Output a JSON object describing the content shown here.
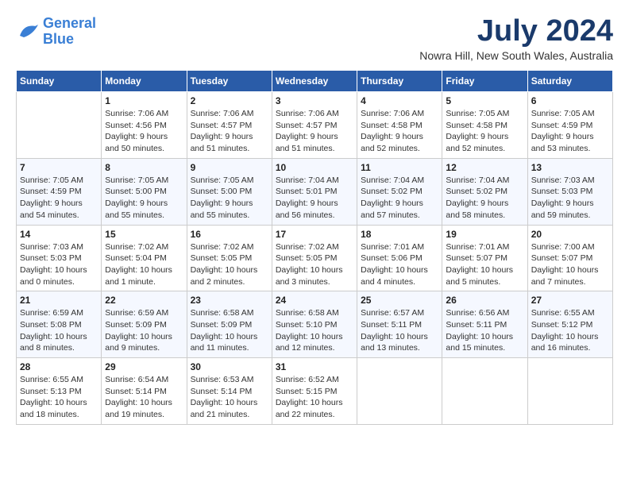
{
  "header": {
    "logo_line1": "General",
    "logo_line2": "Blue",
    "month": "July 2024",
    "location": "Nowra Hill, New South Wales, Australia"
  },
  "weekdays": [
    "Sunday",
    "Monday",
    "Tuesday",
    "Wednesday",
    "Thursday",
    "Friday",
    "Saturday"
  ],
  "weeks": [
    [
      {
        "day": "",
        "info": ""
      },
      {
        "day": "1",
        "info": "Sunrise: 7:06 AM\nSunset: 4:56 PM\nDaylight: 9 hours\nand 50 minutes."
      },
      {
        "day": "2",
        "info": "Sunrise: 7:06 AM\nSunset: 4:57 PM\nDaylight: 9 hours\nand 51 minutes."
      },
      {
        "day": "3",
        "info": "Sunrise: 7:06 AM\nSunset: 4:57 PM\nDaylight: 9 hours\nand 51 minutes."
      },
      {
        "day": "4",
        "info": "Sunrise: 7:06 AM\nSunset: 4:58 PM\nDaylight: 9 hours\nand 52 minutes."
      },
      {
        "day": "5",
        "info": "Sunrise: 7:05 AM\nSunset: 4:58 PM\nDaylight: 9 hours\nand 52 minutes."
      },
      {
        "day": "6",
        "info": "Sunrise: 7:05 AM\nSunset: 4:59 PM\nDaylight: 9 hours\nand 53 minutes."
      }
    ],
    [
      {
        "day": "7",
        "info": "Sunrise: 7:05 AM\nSunset: 4:59 PM\nDaylight: 9 hours\nand 54 minutes."
      },
      {
        "day": "8",
        "info": "Sunrise: 7:05 AM\nSunset: 5:00 PM\nDaylight: 9 hours\nand 55 minutes."
      },
      {
        "day": "9",
        "info": "Sunrise: 7:05 AM\nSunset: 5:00 PM\nDaylight: 9 hours\nand 55 minutes."
      },
      {
        "day": "10",
        "info": "Sunrise: 7:04 AM\nSunset: 5:01 PM\nDaylight: 9 hours\nand 56 minutes."
      },
      {
        "day": "11",
        "info": "Sunrise: 7:04 AM\nSunset: 5:02 PM\nDaylight: 9 hours\nand 57 minutes."
      },
      {
        "day": "12",
        "info": "Sunrise: 7:04 AM\nSunset: 5:02 PM\nDaylight: 9 hours\nand 58 minutes."
      },
      {
        "day": "13",
        "info": "Sunrise: 7:03 AM\nSunset: 5:03 PM\nDaylight: 9 hours\nand 59 minutes."
      }
    ],
    [
      {
        "day": "14",
        "info": "Sunrise: 7:03 AM\nSunset: 5:03 PM\nDaylight: 10 hours\nand 0 minutes."
      },
      {
        "day": "15",
        "info": "Sunrise: 7:02 AM\nSunset: 5:04 PM\nDaylight: 10 hours\nand 1 minute."
      },
      {
        "day": "16",
        "info": "Sunrise: 7:02 AM\nSunset: 5:05 PM\nDaylight: 10 hours\nand 2 minutes."
      },
      {
        "day": "17",
        "info": "Sunrise: 7:02 AM\nSunset: 5:05 PM\nDaylight: 10 hours\nand 3 minutes."
      },
      {
        "day": "18",
        "info": "Sunrise: 7:01 AM\nSunset: 5:06 PM\nDaylight: 10 hours\nand 4 minutes."
      },
      {
        "day": "19",
        "info": "Sunrise: 7:01 AM\nSunset: 5:07 PM\nDaylight: 10 hours\nand 5 minutes."
      },
      {
        "day": "20",
        "info": "Sunrise: 7:00 AM\nSunset: 5:07 PM\nDaylight: 10 hours\nand 7 minutes."
      }
    ],
    [
      {
        "day": "21",
        "info": "Sunrise: 6:59 AM\nSunset: 5:08 PM\nDaylight: 10 hours\nand 8 minutes."
      },
      {
        "day": "22",
        "info": "Sunrise: 6:59 AM\nSunset: 5:09 PM\nDaylight: 10 hours\nand 9 minutes."
      },
      {
        "day": "23",
        "info": "Sunrise: 6:58 AM\nSunset: 5:09 PM\nDaylight: 10 hours\nand 11 minutes."
      },
      {
        "day": "24",
        "info": "Sunrise: 6:58 AM\nSunset: 5:10 PM\nDaylight: 10 hours\nand 12 minutes."
      },
      {
        "day": "25",
        "info": "Sunrise: 6:57 AM\nSunset: 5:11 PM\nDaylight: 10 hours\nand 13 minutes."
      },
      {
        "day": "26",
        "info": "Sunrise: 6:56 AM\nSunset: 5:11 PM\nDaylight: 10 hours\nand 15 minutes."
      },
      {
        "day": "27",
        "info": "Sunrise: 6:55 AM\nSunset: 5:12 PM\nDaylight: 10 hours\nand 16 minutes."
      }
    ],
    [
      {
        "day": "28",
        "info": "Sunrise: 6:55 AM\nSunset: 5:13 PM\nDaylight: 10 hours\nand 18 minutes."
      },
      {
        "day": "29",
        "info": "Sunrise: 6:54 AM\nSunset: 5:14 PM\nDaylight: 10 hours\nand 19 minutes."
      },
      {
        "day": "30",
        "info": "Sunrise: 6:53 AM\nSunset: 5:14 PM\nDaylight: 10 hours\nand 21 minutes."
      },
      {
        "day": "31",
        "info": "Sunrise: 6:52 AM\nSunset: 5:15 PM\nDaylight: 10 hours\nand 22 minutes."
      },
      {
        "day": "",
        "info": ""
      },
      {
        "day": "",
        "info": ""
      },
      {
        "day": "",
        "info": ""
      }
    ]
  ]
}
